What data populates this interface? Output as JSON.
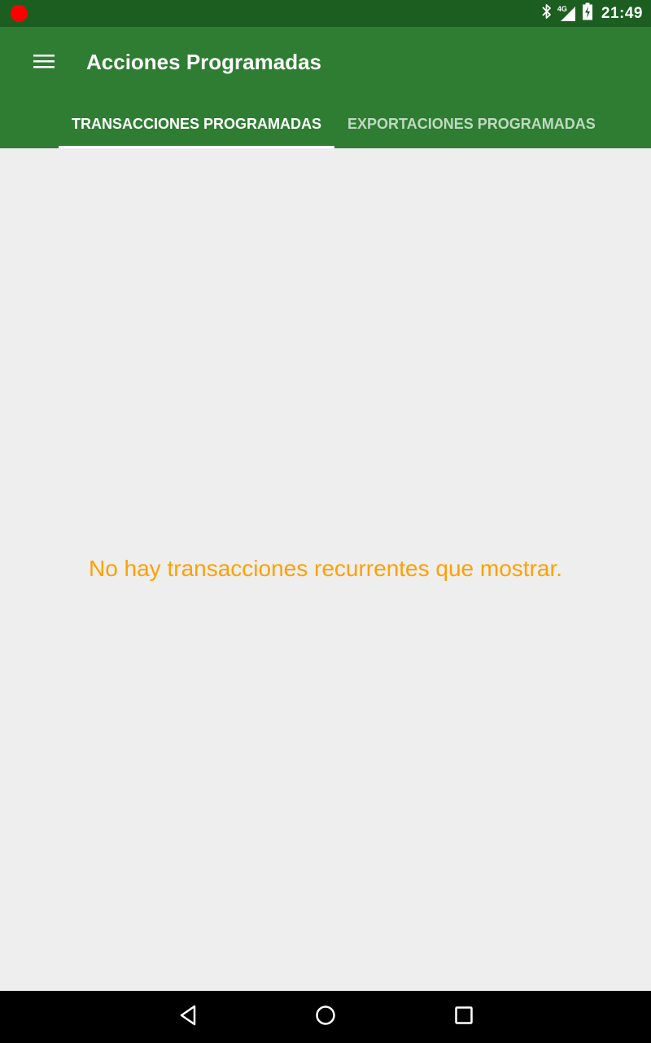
{
  "status_bar": {
    "time": "21:49",
    "network": "4G",
    "icons": [
      "recording-dot-icon",
      "bluetooth-icon",
      "signal-icon",
      "battery-charging-icon"
    ]
  },
  "app_bar": {
    "title": "Acciones Programadas",
    "menu_icon": "menu-icon"
  },
  "tabs": [
    {
      "label": "TRANSACCIONES PROGRAMADAS",
      "active": true
    },
    {
      "label": "EXPORTACIONES PROGRAMADAS",
      "active": false
    }
  ],
  "content": {
    "empty_message": "No hay transacciones recurrentes que mostrar."
  },
  "navigation_bar": {
    "icons": [
      "back-icon",
      "home-icon",
      "recents-icon"
    ]
  },
  "colors": {
    "status_bar": "#1b5e20",
    "app_bar": "#2e7d32",
    "background": "#eeeeee",
    "empty_message": "#ffa000",
    "recording_dot": "#ff0000"
  }
}
